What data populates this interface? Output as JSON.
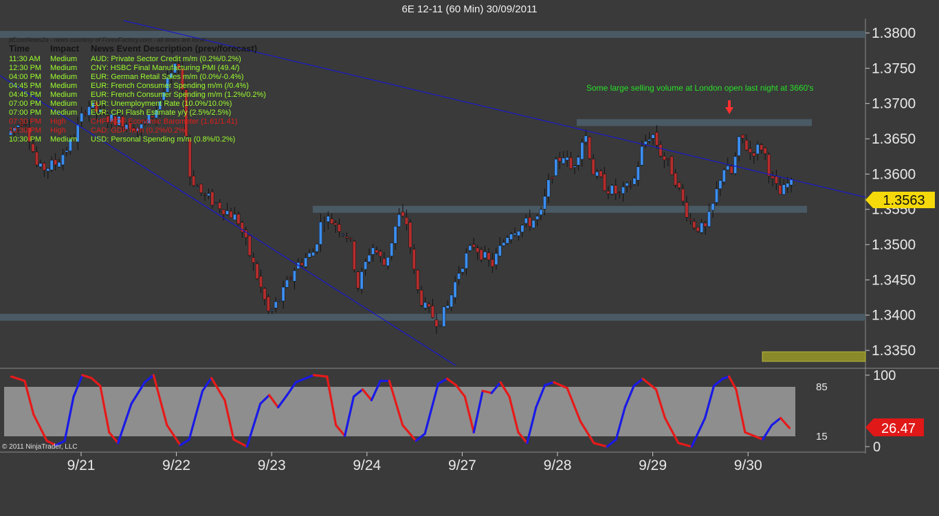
{
  "window": {
    "title": "6E 12-11 (60 Min)  30/09/2011"
  },
  "news_panel": {
    "source": "jtEconNews2a - news courtesy of ForexFactory.com - all times are local",
    "headers": {
      "time": "Time",
      "impact": "Impact",
      "description": "News Event Description (prev/forecast)"
    },
    "rows": [
      {
        "time": "11:30 AM",
        "impact": "Medium",
        "desc": "AUD: Private Sector Credit m/m (0.2%/0.2%)",
        "color": "#9cff2e"
      },
      {
        "time": "12:30 PM",
        "impact": "Medium",
        "desc": "CNY: HSBC Final Manufacturing PMI (49.4/)",
        "color": "#9cff2e"
      },
      {
        "time": "04:00 PM",
        "impact": "Medium",
        "desc": "EUR: German Retail Sales m/m (0.0%/-0.4%)",
        "color": "#9cff2e"
      },
      {
        "time": "04:45 PM",
        "impact": "Medium",
        "desc": "EUR: French Consumer Spending m/m (/0.4%)",
        "color": "#9cff2e"
      },
      {
        "time": "04:45 PM",
        "impact": "Medium",
        "desc": "EUR: French Consumer Spending m/m (1.2%/0.2%)",
        "color": "#9cff2e"
      },
      {
        "time": "07:00 PM",
        "impact": "Medium",
        "desc": "EUR: Unemployment Rate (10.0%/10.0%)",
        "color": "#9cff2e"
      },
      {
        "time": "07:00 PM",
        "impact": "Medium",
        "desc": "EUR: CPI Flash Estimate y/y (2.5%/2.5%)",
        "color": "#9cff2e"
      },
      {
        "time": "07:30 PM",
        "impact": "High",
        "desc": "CHF: KOF Economic Barometer (1.61/1.41)",
        "color": "#e0201a"
      },
      {
        "time": "10:30 PM",
        "impact": "High",
        "desc": "CAD: GDP m/m (0.2%/0.2%)",
        "color": "#e0201a"
      },
      {
        "time": "10:30 PM",
        "impact": "Medium",
        "desc": "USD: Personal Spending m/m (0.8%/0.2%)",
        "color": "#9cff2e"
      }
    ]
  },
  "annotation": "Some large selling volume at London open last night at 3660's",
  "copyright": "© 2011 NinjaTrader, LLC",
  "colors": {
    "background": "#3a3a3a",
    "up_candle": "#3c8ef0",
    "down_candle": "#b52d2d",
    "trendline": "#1a1ac8",
    "zone": "#4a5a64",
    "price_badge": "#f5d90a",
    "osc_badge": "#e01818",
    "osc_up": "#1a1ae6",
    "osc_down": "#e61a1a"
  },
  "chart_data": [
    {
      "type": "candlestick",
      "instrument": "6E 12-11",
      "interval": "60 Min",
      "y_axis": {
        "ticks": [
          "1.3800",
          "1.3750",
          "1.3700",
          "1.3650",
          "1.3600",
          "1.3550",
          "1.3500",
          "1.3450",
          "1.3400",
          "1.3350"
        ],
        "ylim": [
          1.3315,
          1.3815
        ]
      },
      "x_axis": {
        "ticks": [
          "9/21",
          "9/22",
          "9/23",
          "9/24",
          "9/27",
          "9/28",
          "9/29",
          "9/30"
        ]
      },
      "last_price": "1.3563",
      "zones": [
        {
          "level": 1.3798
        },
        {
          "level": 1.3673
        },
        {
          "level": 1.355
        },
        {
          "level": 1.3397
        }
      ],
      "trendlines": [
        {
          "from": [
            "9/21 early",
            1.3795
          ],
          "to": [
            "9/30 end",
            1.3566
          ]
        },
        {
          "from": [
            "9/20 late",
            1.3748
          ],
          "to": [
            "9/24 late",
            1.332
          ]
        }
      ],
      "path": [
        [
          0,
          1.3655
        ],
        [
          0.2,
          1.368
        ],
        [
          0.35,
          1.3605
        ],
        [
          0.55,
          1.3615
        ],
        [
          0.75,
          1.365
        ],
        [
          0.9,
          1.37
        ],
        [
          1.1,
          1.368
        ],
        [
          1.3,
          1.3675
        ],
        [
          1.5,
          1.3665
        ],
        [
          1.65,
          1.3685
        ],
        [
          1.85,
          1.374
        ],
        [
          1.95,
          1.376
        ],
        [
          2.05,
          1.36
        ],
        [
          2.2,
          1.357
        ],
        [
          2.4,
          1.3555
        ],
        [
          2.6,
          1.3535
        ],
        [
          2.8,
          1.346
        ],
        [
          2.95,
          1.34
        ],
        [
          3.1,
          1.343
        ],
        [
          3.25,
          1.347
        ],
        [
          3.45,
          1.349
        ],
        [
          3.55,
          1.354
        ],
        [
          3.7,
          1.353
        ],
        [
          3.85,
          1.351
        ],
        [
          3.95,
          1.344
        ],
        [
          4.1,
          1.35
        ],
        [
          4.25,
          1.347
        ],
        [
          4.4,
          1.354
        ],
        [
          4.5,
          1.353
        ],
        [
          4.6,
          1.344
        ],
        [
          4.7,
          1.341
        ],
        [
          4.85,
          1.339
        ],
        [
          4.95,
          1.341
        ],
        [
          5.1,
          1.347
        ],
        [
          5.25,
          1.35
        ],
        [
          5.45,
          1.347
        ],
        [
          5.65,
          1.352
        ],
        [
          5.85,
          1.353
        ],
        [
          6.0,
          1.354
        ],
        [
          6.12,
          1.36
        ],
        [
          6.25,
          1.363
        ],
        [
          6.35,
          1.3605
        ],
        [
          6.5,
          1.366
        ],
        [
          6.6,
          1.36
        ],
        [
          6.75,
          1.358
        ],
        [
          6.9,
          1.357
        ],
        [
          7.05,
          1.359
        ],
        [
          7.15,
          1.364
        ],
        [
          7.25,
          1.366
        ],
        [
          7.35,
          1.363
        ],
        [
          7.5,
          1.36
        ],
        [
          7.6,
          1.356
        ],
        [
          7.7,
          1.353
        ],
        [
          7.85,
          1.352
        ],
        [
          7.95,
          1.356
        ],
        [
          8.05,
          1.361
        ],
        [
          8.15,
          1.36
        ],
        [
          8.25,
          1.3655
        ],
        [
          8.35,
          1.363
        ],
        [
          8.5,
          1.364
        ],
        [
          8.6,
          1.359
        ],
        [
          8.7,
          1.357
        ],
        [
          8.8,
          1.359
        ],
        [
          8.85,
          1.3575
        ]
      ]
    },
    {
      "type": "line",
      "name": "oscillator",
      "y_axis": {
        "ticks": [
          "100",
          "0"
        ],
        "ylim": [
          0,
          100
        ]
      },
      "bands": {
        "upper": 85,
        "lower": 15
      },
      "last_value": "26.47",
      "path": [
        [
          0.05,
          98
        ],
        [
          0.2,
          92
        ],
        [
          0.3,
          45
        ],
        [
          0.45,
          8
        ],
        [
          0.55,
          2
        ],
        [
          0.65,
          8
        ],
        [
          0.75,
          70
        ],
        [
          0.85,
          100
        ],
        [
          0.95,
          96
        ],
        [
          1.05,
          85
        ],
        [
          1.15,
          20
        ],
        [
          1.25,
          5
        ],
        [
          1.4,
          60
        ],
        [
          1.55,
          90
        ],
        [
          1.65,
          100
        ],
        [
          1.8,
          30
        ],
        [
          1.95,
          2
        ],
        [
          2.05,
          10
        ],
        [
          2.2,
          78
        ],
        [
          2.3,
          96
        ],
        [
          2.45,
          65
        ],
        [
          2.55,
          10
        ],
        [
          2.7,
          0
        ],
        [
          2.85,
          60
        ],
        [
          2.95,
          72
        ],
        [
          3.05,
          55
        ],
        [
          3.15,
          72
        ],
        [
          3.25,
          90
        ],
        [
          3.45,
          100
        ],
        [
          3.6,
          98
        ],
        [
          3.7,
          30
        ],
        [
          3.8,
          15
        ],
        [
          3.9,
          70
        ],
        [
          4.0,
          80
        ],
        [
          4.1,
          65
        ],
        [
          4.2,
          92
        ],
        [
          4.3,
          92
        ],
        [
          4.45,
          30
        ],
        [
          4.6,
          8
        ],
        [
          4.7,
          18
        ],
        [
          4.85,
          88
        ],
        [
          4.95,
          95
        ],
        [
          5.05,
          86
        ],
        [
          5.15,
          70
        ],
        [
          5.25,
          20
        ],
        [
          5.35,
          78
        ],
        [
          5.45,
          75
        ],
        [
          5.55,
          90
        ],
        [
          5.65,
          70
        ],
        [
          5.75,
          20
        ],
        [
          5.85,
          5
        ],
        [
          5.95,
          55
        ],
        [
          6.05,
          86
        ],
        [
          6.15,
          90
        ],
        [
          6.3,
          82
        ],
        [
          6.45,
          35
        ],
        [
          6.6,
          5
        ],
        [
          6.75,
          0
        ],
        [
          6.85,
          10
        ],
        [
          6.95,
          55
        ],
        [
          7.05,
          85
        ],
        [
          7.15,
          95
        ],
        [
          7.3,
          80
        ],
        [
          7.4,
          40
        ],
        [
          7.55,
          5
        ],
        [
          7.7,
          0
        ],
        [
          7.85,
          40
        ],
        [
          7.95,
          85
        ],
        [
          8.05,
          95
        ],
        [
          8.12,
          98
        ],
        [
          8.2,
          80
        ],
        [
          8.3,
          20
        ],
        [
          8.4,
          15
        ],
        [
          8.5,
          10
        ],
        [
          8.6,
          30
        ],
        [
          8.7,
          40
        ],
        [
          8.8,
          26
        ]
      ]
    }
  ]
}
